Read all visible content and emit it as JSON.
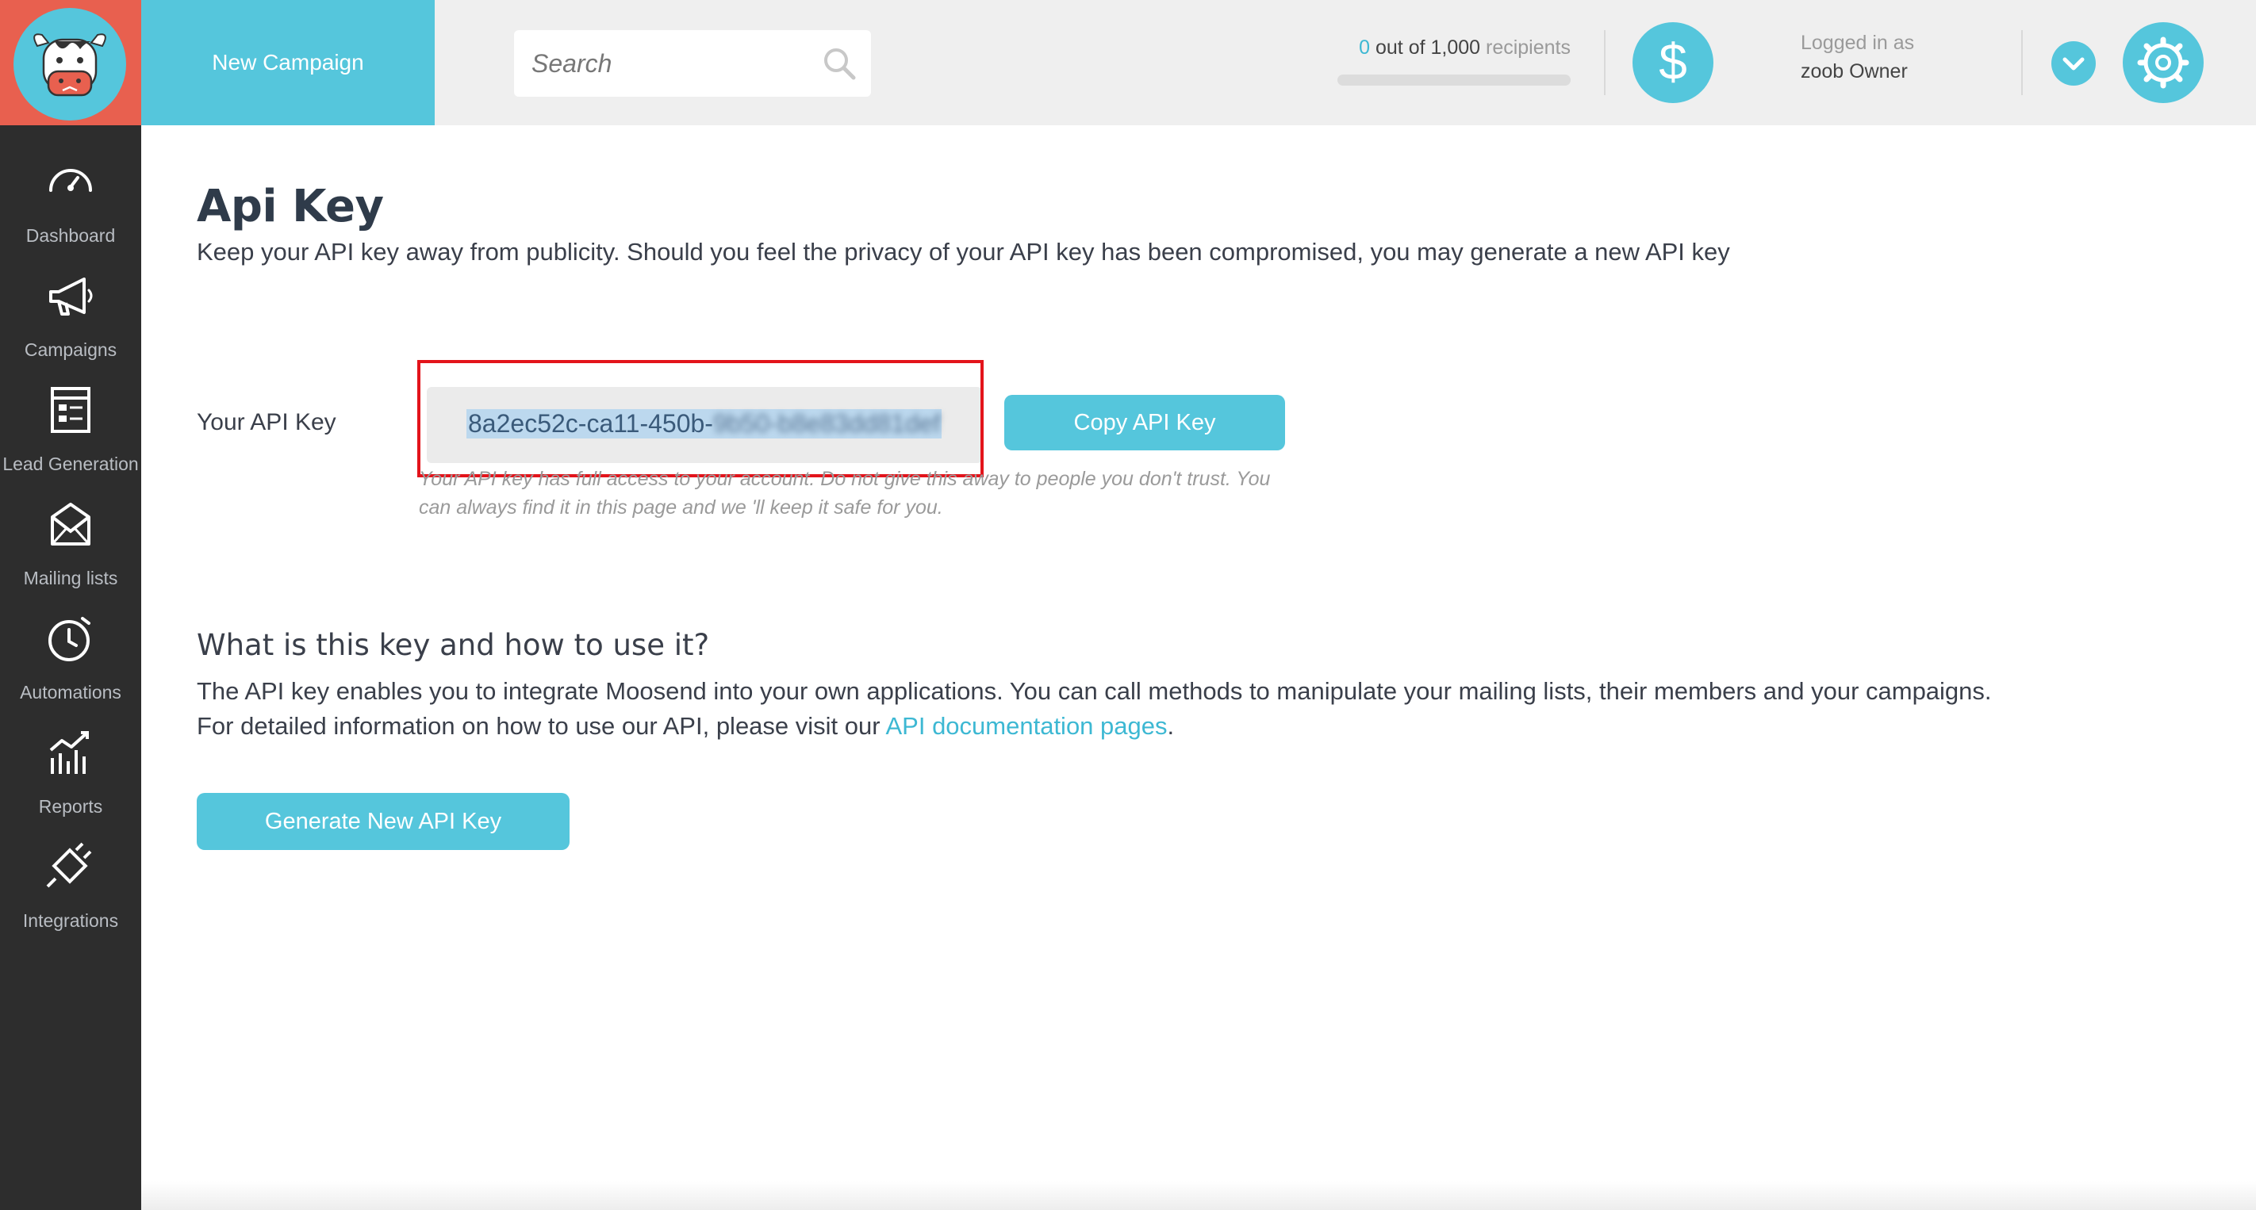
{
  "header": {
    "new_campaign_label": "New Campaign",
    "search_placeholder": "Search",
    "recipients": {
      "count": "0",
      "middle": " out of 1,000 ",
      "word": "recipients",
      "used_fraction": 0
    },
    "logged_in_label": "Logged in as",
    "user_name": "zoob Owner"
  },
  "sidebar": {
    "items": [
      {
        "label": "Dashboard",
        "icon": "speedometer-icon"
      },
      {
        "label": "Campaigns",
        "icon": "megaphone-icon"
      },
      {
        "label": "Lead Generation",
        "icon": "form-icon"
      },
      {
        "label": "Mailing lists",
        "icon": "envelope-icon"
      },
      {
        "label": "Automations",
        "icon": "timer-icon"
      },
      {
        "label": "Reports",
        "icon": "bar-chart-icon"
      },
      {
        "label": "Integrations",
        "icon": "plug-icon"
      }
    ]
  },
  "main": {
    "title": "Api Key",
    "subtitle": "Keep your API key away from publicity. Should you feel the privacy of your API key has been compromised, you may generate a new API key",
    "api_key_label": "Your API Key",
    "api_key_visible": "8a2ec52c-ca11-450b-",
    "api_key_blurred": "9b50-b8e83dd81def",
    "api_key_note_1": "Your API key has full access to your account. Do not give this away to people you don't trust. You",
    "api_key_note_2": "can always find it in this page and we 'll keep it safe for you.",
    "copy_button": "Copy API Key",
    "what_title": "What is this key and how to use it?",
    "what_p1": "The API key enables you to integrate Moosend into your own applications. You can call methods to manipulate your mailing lists, their members and your campaigns.",
    "what_p2_before": "For detailed information on how to use our API, please visit our ",
    "what_p2_link": "API documentation pages",
    "what_p2_after": ".",
    "generate_button": "Generate New API Key"
  },
  "colors": {
    "accent": "#55c6dc",
    "logo_bg": "#e8604f",
    "sidebar_bg": "#2d2d2d",
    "highlight_frame": "#e3141b"
  }
}
